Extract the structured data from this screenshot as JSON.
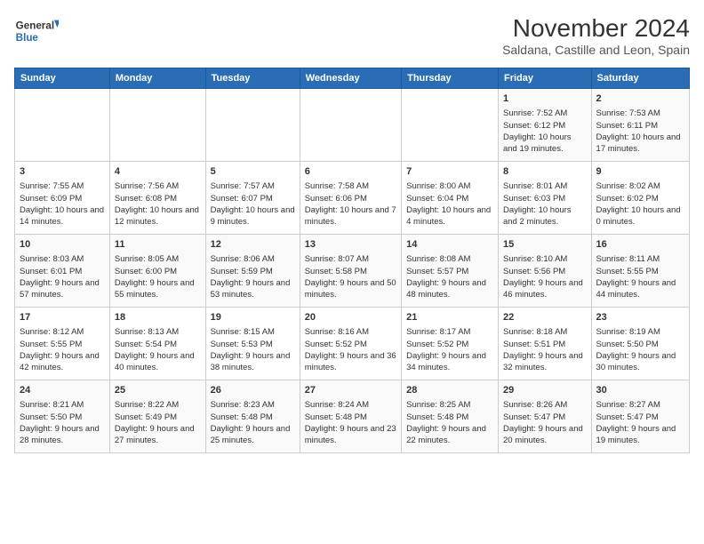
{
  "header": {
    "logo_line1": "General",
    "logo_line2": "Blue",
    "title": "November 2024",
    "subtitle": "Saldana, Castille and Leon, Spain"
  },
  "days_of_week": [
    "Sunday",
    "Monday",
    "Tuesday",
    "Wednesday",
    "Thursday",
    "Friday",
    "Saturday"
  ],
  "weeks": [
    [
      {
        "day": "",
        "content": ""
      },
      {
        "day": "",
        "content": ""
      },
      {
        "day": "",
        "content": ""
      },
      {
        "day": "",
        "content": ""
      },
      {
        "day": "",
        "content": ""
      },
      {
        "day": "1",
        "content": "Sunrise: 7:52 AM\nSunset: 6:12 PM\nDaylight: 10 hours and 19 minutes."
      },
      {
        "day": "2",
        "content": "Sunrise: 7:53 AM\nSunset: 6:11 PM\nDaylight: 10 hours and 17 minutes."
      }
    ],
    [
      {
        "day": "3",
        "content": "Sunrise: 7:55 AM\nSunset: 6:09 PM\nDaylight: 10 hours and 14 minutes."
      },
      {
        "day": "4",
        "content": "Sunrise: 7:56 AM\nSunset: 6:08 PM\nDaylight: 10 hours and 12 minutes."
      },
      {
        "day": "5",
        "content": "Sunrise: 7:57 AM\nSunset: 6:07 PM\nDaylight: 10 hours and 9 minutes."
      },
      {
        "day": "6",
        "content": "Sunrise: 7:58 AM\nSunset: 6:06 PM\nDaylight: 10 hours and 7 minutes."
      },
      {
        "day": "7",
        "content": "Sunrise: 8:00 AM\nSunset: 6:04 PM\nDaylight: 10 hours and 4 minutes."
      },
      {
        "day": "8",
        "content": "Sunrise: 8:01 AM\nSunset: 6:03 PM\nDaylight: 10 hours and 2 minutes."
      },
      {
        "day": "9",
        "content": "Sunrise: 8:02 AM\nSunset: 6:02 PM\nDaylight: 10 hours and 0 minutes."
      }
    ],
    [
      {
        "day": "10",
        "content": "Sunrise: 8:03 AM\nSunset: 6:01 PM\nDaylight: 9 hours and 57 minutes."
      },
      {
        "day": "11",
        "content": "Sunrise: 8:05 AM\nSunset: 6:00 PM\nDaylight: 9 hours and 55 minutes."
      },
      {
        "day": "12",
        "content": "Sunrise: 8:06 AM\nSunset: 5:59 PM\nDaylight: 9 hours and 53 minutes."
      },
      {
        "day": "13",
        "content": "Sunrise: 8:07 AM\nSunset: 5:58 PM\nDaylight: 9 hours and 50 minutes."
      },
      {
        "day": "14",
        "content": "Sunrise: 8:08 AM\nSunset: 5:57 PM\nDaylight: 9 hours and 48 minutes."
      },
      {
        "day": "15",
        "content": "Sunrise: 8:10 AM\nSunset: 5:56 PM\nDaylight: 9 hours and 46 minutes."
      },
      {
        "day": "16",
        "content": "Sunrise: 8:11 AM\nSunset: 5:55 PM\nDaylight: 9 hours and 44 minutes."
      }
    ],
    [
      {
        "day": "17",
        "content": "Sunrise: 8:12 AM\nSunset: 5:55 PM\nDaylight: 9 hours and 42 minutes."
      },
      {
        "day": "18",
        "content": "Sunrise: 8:13 AM\nSunset: 5:54 PM\nDaylight: 9 hours and 40 minutes."
      },
      {
        "day": "19",
        "content": "Sunrise: 8:15 AM\nSunset: 5:53 PM\nDaylight: 9 hours and 38 minutes."
      },
      {
        "day": "20",
        "content": "Sunrise: 8:16 AM\nSunset: 5:52 PM\nDaylight: 9 hours and 36 minutes."
      },
      {
        "day": "21",
        "content": "Sunrise: 8:17 AM\nSunset: 5:52 PM\nDaylight: 9 hours and 34 minutes."
      },
      {
        "day": "22",
        "content": "Sunrise: 8:18 AM\nSunset: 5:51 PM\nDaylight: 9 hours and 32 minutes."
      },
      {
        "day": "23",
        "content": "Sunrise: 8:19 AM\nSunset: 5:50 PM\nDaylight: 9 hours and 30 minutes."
      }
    ],
    [
      {
        "day": "24",
        "content": "Sunrise: 8:21 AM\nSunset: 5:50 PM\nDaylight: 9 hours and 28 minutes."
      },
      {
        "day": "25",
        "content": "Sunrise: 8:22 AM\nSunset: 5:49 PM\nDaylight: 9 hours and 27 minutes."
      },
      {
        "day": "26",
        "content": "Sunrise: 8:23 AM\nSunset: 5:48 PM\nDaylight: 9 hours and 25 minutes."
      },
      {
        "day": "27",
        "content": "Sunrise: 8:24 AM\nSunset: 5:48 PM\nDaylight: 9 hours and 23 minutes."
      },
      {
        "day": "28",
        "content": "Sunrise: 8:25 AM\nSunset: 5:48 PM\nDaylight: 9 hours and 22 minutes."
      },
      {
        "day": "29",
        "content": "Sunrise: 8:26 AM\nSunset: 5:47 PM\nDaylight: 9 hours and 20 minutes."
      },
      {
        "day": "30",
        "content": "Sunrise: 8:27 AM\nSunset: 5:47 PM\nDaylight: 9 hours and 19 minutes."
      }
    ]
  ]
}
